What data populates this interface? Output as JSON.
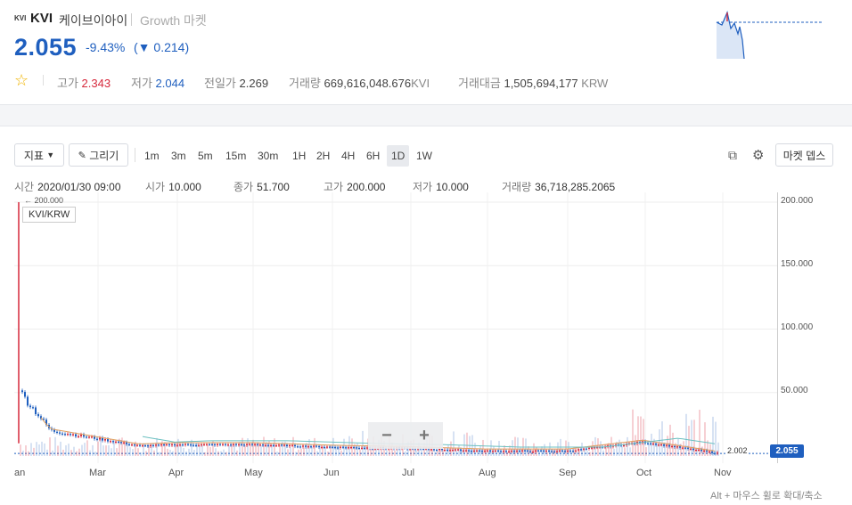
{
  "header": {
    "symbol_small": "KVI",
    "symbol": "KVI",
    "korean_name": "케이브이아이",
    "market": "Growth 마켓",
    "price": "2.055",
    "change_pct": "-9.43%",
    "change_abs": "(▼ 0.214)",
    "stats": {
      "high_label": "고가",
      "high": "2.343",
      "low_label": "저가",
      "low": "2.044",
      "prev_label": "전일가",
      "prev": "2.269",
      "volume_label": "거래량",
      "volume": "669,616,048.676",
      "volume_unit": "KVI",
      "amount_label": "거래대금",
      "amount": "1,505,694,177",
      "amount_unit": "KRW"
    },
    "star_icon": "star-outline-icon"
  },
  "toolbar": {
    "indicator_label": "지표",
    "draw_label": "그리기",
    "timeframes": [
      "1m",
      "3m",
      "5m",
      "15m",
      "30m",
      "1H",
      "2H",
      "4H",
      "6H",
      "1D",
      "1W"
    ],
    "active_timeframe": "1D",
    "market_depth_label": "마켓 뎁스"
  },
  "ohlc": {
    "time_label": "시간",
    "time": "2020/01/30 09:00",
    "open_label": "시가",
    "open": "10.000",
    "close_label": "종가",
    "close": "51.700",
    "high_label": "고가",
    "high": "200.000",
    "low_label": "저가",
    "low": "10.000",
    "volume_label": "거래량",
    "volume": "36,718,285.2065"
  },
  "chart": {
    "pair_label": "KVI/KRW",
    "max_marker": "← 200.000",
    "last_line_value": "2.002",
    "current_price_tag": "2.055",
    "zoom_out": "−",
    "zoom_in": "+",
    "hint": "Alt + 마우스 휠로 확대/축소"
  },
  "chart_data": {
    "type": "candlestick",
    "y_ticks": [
      "200.000",
      "150.000",
      "100.000",
      "50.000"
    ],
    "x_ticks": [
      "an",
      "Mar",
      "Apr",
      "May",
      "Jun",
      "Jul",
      "Aug",
      "Sep",
      "Oct",
      "Nov"
    ],
    "ylim": [
      0,
      200
    ],
    "approx_close": [
      {
        "x": "Jan-30",
        "y": 51.7
      },
      {
        "x": "Feb",
        "y": 20
      },
      {
        "x": "Mar",
        "y": 14
      },
      {
        "x": "Mar-end",
        "y": 8
      },
      {
        "x": "Apr",
        "y": 9
      },
      {
        "x": "May",
        "y": 9
      },
      {
        "x": "Jun",
        "y": 7
      },
      {
        "x": "Jul",
        "y": 6
      },
      {
        "x": "Aug",
        "y": 4
      },
      {
        "x": "Sep",
        "y": 4
      },
      {
        "x": "Oct",
        "y": 11
      },
      {
        "x": "Nov",
        "y": 2.055
      }
    ],
    "grid": true,
    "colors": {
      "up": "#d6293c",
      "down": "#1f5fbf",
      "ma": "#e0a060",
      "ma2": "#6cc0c0"
    }
  }
}
